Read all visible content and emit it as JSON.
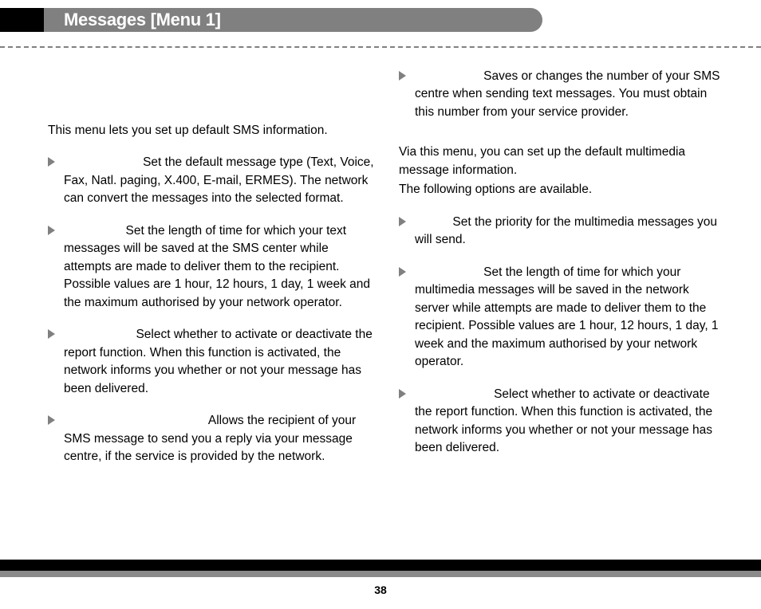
{
  "title": "Messages [Menu 1]",
  "page_number": "38",
  "left": {
    "intro": "This menu lets you set up default SMS information.",
    "items": [
      "Set the default message type (Text, Voice, Fax, Natl. paging, X.400, E-mail, ERMES). The network can convert the messages into the selected format.",
      "Set the length of time for which your text messages will be saved at the SMS center while attempts are made to deliver them to the recipient. Possible values are 1 hour, 12 hours, 1 day, 1 week and the maximum authorised by your network operator.",
      "Select whether to activate or deactivate the report function. When this function is activated, the network informs you whether or not your message has been delivered.",
      "Allows the recipient of your SMS message to send you a reply via your message centre, if the service is provided by the network."
    ]
  },
  "right": {
    "top_item": "Saves or changes the number of your SMS centre when sending text messages. You must obtain this number from your service provider.",
    "intro1": "Via this menu, you can set up the default multimedia message information.",
    "intro2": "The following options are available.",
    "items": [
      "Set the priority for the multimedia messages you will send.",
      "Set the length of time for which your multimedia messages will be saved in the network server while attempts are made to deliver them to the recipient. Possible values are 1 hour, 12 hours, 1 day, 1 week and the maximum authorised by your network operator.",
      "Select whether to activate or deactivate the report function. When this function is activated, the network informs you whether or not your message has been delivered."
    ]
  },
  "lead_spaces": {
    "l0": "                       ",
    "l1": "                  ",
    "l2": "                     ",
    "l3": "                                          ",
    "r0": "                    ",
    "r1": "           ",
    "r2": "                    ",
    "r3": "                       "
  }
}
